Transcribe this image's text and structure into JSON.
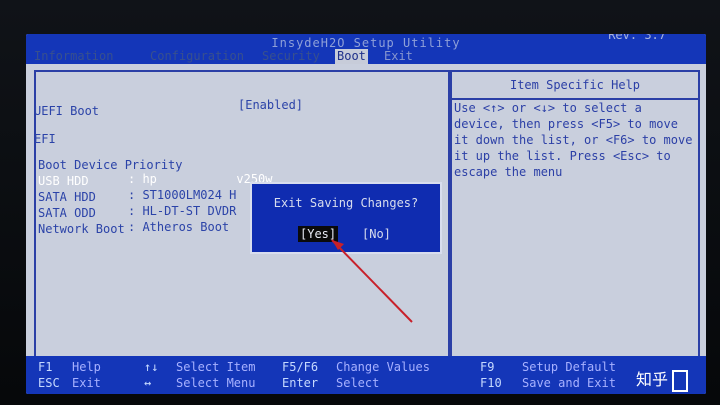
{
  "app": {
    "title": "InsydeH2O Setup Utility",
    "revision": "Rev. 3.7"
  },
  "menus": [
    {
      "label": "Information",
      "active": false
    },
    {
      "label": "Configuration",
      "active": false
    },
    {
      "label": "Security",
      "active": false
    },
    {
      "label": "Boot",
      "active": true
    },
    {
      "label": "Exit",
      "active": false
    }
  ],
  "left": {
    "uefi_boot_label": "UEFI Boot",
    "uefi_boot_value": "[Enabled]",
    "efi_label": "EFI",
    "boot_priority_label": "Boot Device Priority",
    "devices": [
      {
        "name": "USB HDD",
        "value": ": hp           v250w"
      },
      {
        "name": "SATA HDD",
        "value": ": ST1000LM024 H"
      },
      {
        "name": "SATA ODD",
        "value": ": HL-DT-ST DVDR"
      },
      {
        "name": "Network Boot",
        "value": ": Atheros Boot"
      }
    ]
  },
  "help": {
    "header": "Item Specific Help",
    "text": "Use <↑> or <↓> to select a device, then press <F5> to move it down the list, or <F6> to move it up the list. Press <Esc> to escape the menu"
  },
  "dialog": {
    "title": "Exit Saving Changes?",
    "yes": "[Yes]",
    "no": "[No]"
  },
  "footer": {
    "f1": "F1",
    "help": "Help",
    "esc": "ESC",
    "exit": "Exit",
    "updown": "↑↓",
    "select_item": "Select Item",
    "leftright": "↔",
    "select_menu": "Select Menu",
    "f5f6": "F5/F6",
    "change_values": "Change Values",
    "enter": "Enter",
    "select": "Select",
    "f9": "F9",
    "setup_default": "Setup Default",
    "f10": "F10",
    "save_exit": "Save and Exit"
  },
  "watermark": {
    "text": "知乎"
  },
  "colors": {
    "bios_blue": "#1436b8",
    "panel_bg": "#c9cfdd",
    "text_blue": "#2b43a8",
    "annotation_red": "#c8202a"
  }
}
